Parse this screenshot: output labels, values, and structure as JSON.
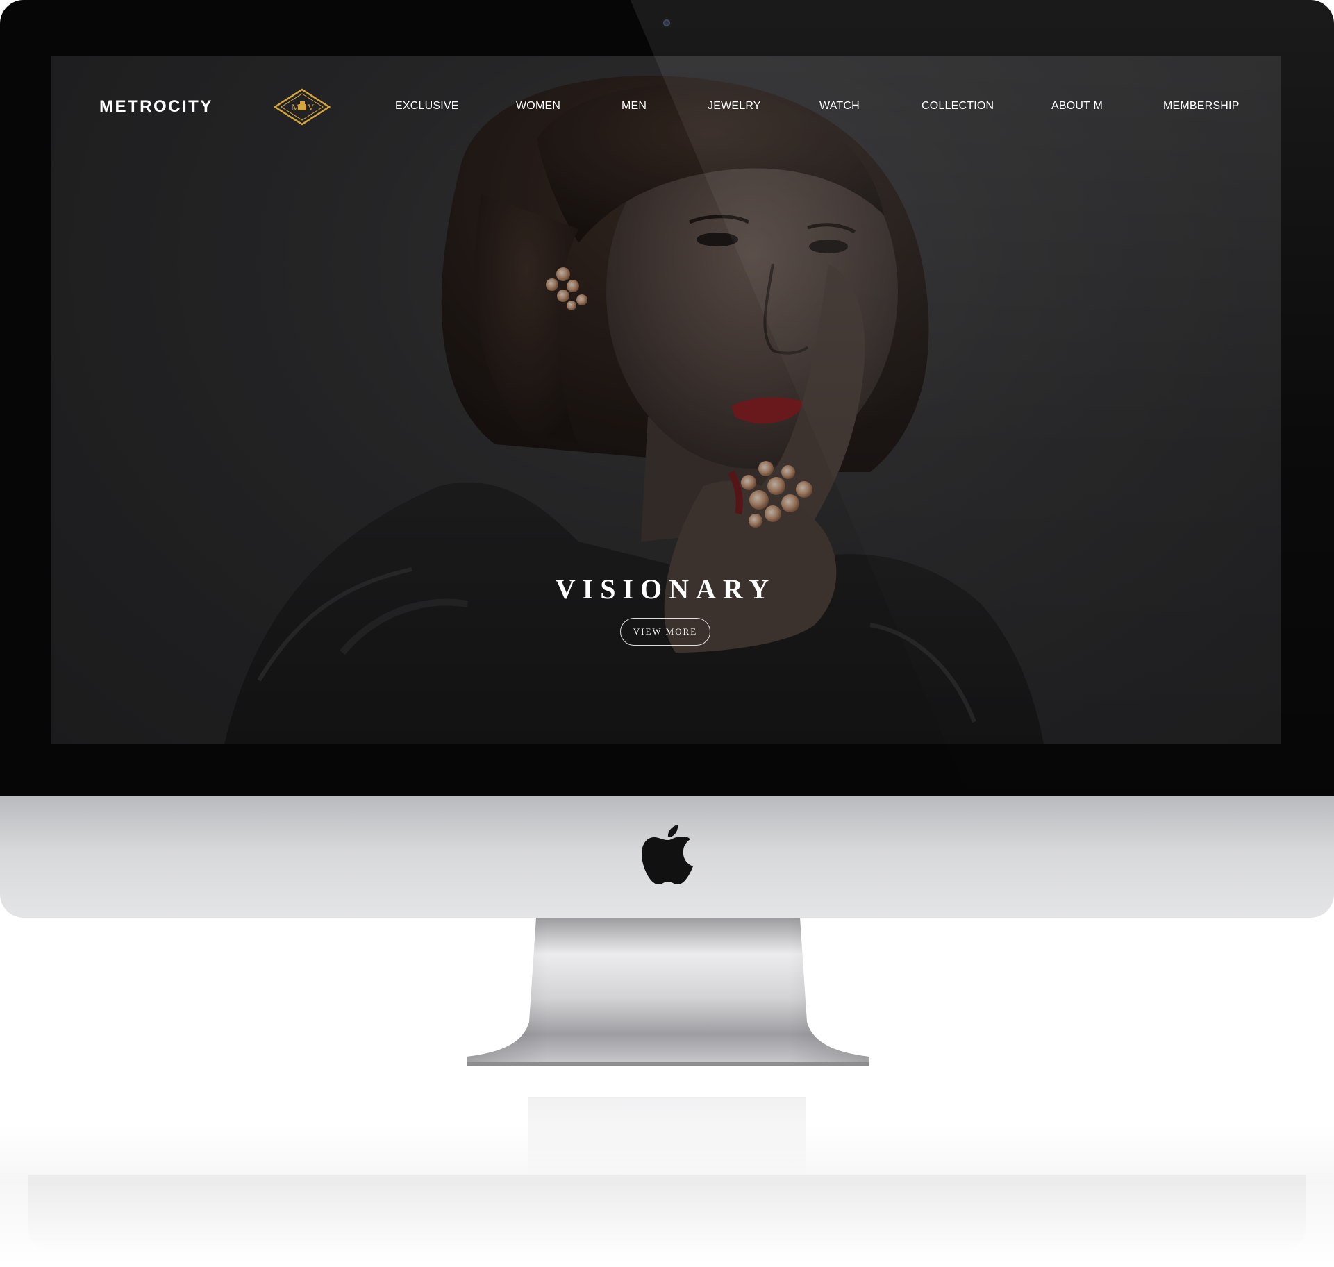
{
  "site": {
    "brand": "METROCITY",
    "logo_mark_left": "M",
    "logo_mark_right": "V"
  },
  "nav": {
    "items": [
      {
        "label": "EXCLUSIVE"
      },
      {
        "label": "WOMEN"
      },
      {
        "label": "MEN"
      },
      {
        "label": "JEWELRY"
      },
      {
        "label": "WATCH"
      },
      {
        "label": "COLLECTION"
      },
      {
        "label": "ABOUT M"
      },
      {
        "label": "MEMBERSHIP"
      }
    ]
  },
  "hero": {
    "title": "VISIONARY",
    "cta_label": "VIEW MORE"
  },
  "colors": {
    "accent_gold": "#d4a53c",
    "screen_bg": "#2b2b2d",
    "text": "#ffffff"
  },
  "device": {
    "logo_icon": "apple-logo-icon",
    "camera_icon": "camera-icon"
  }
}
